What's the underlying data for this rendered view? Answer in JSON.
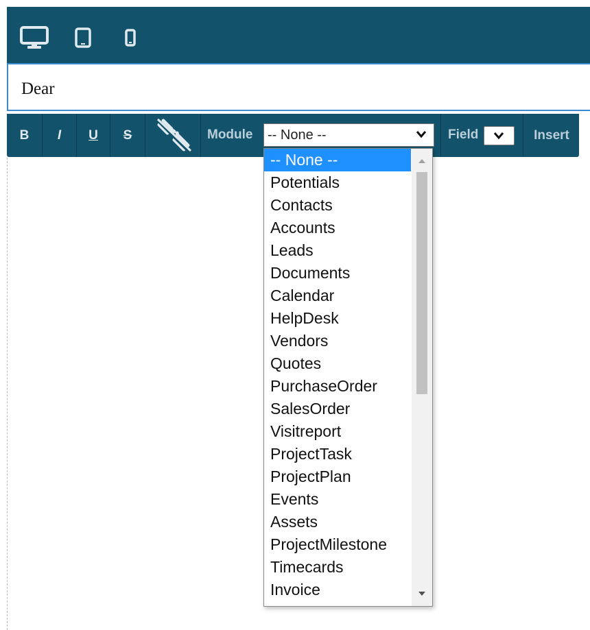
{
  "device_bar": {
    "icons": [
      "desktop-icon",
      "tablet-icon",
      "mobile-icon"
    ]
  },
  "editor": {
    "text": "Dear"
  },
  "toolbar": {
    "bold": "B",
    "italic": "I",
    "underline": "U",
    "strikethrough": "S",
    "link_icon": "unlink-icon",
    "module_label": "Module",
    "module_value": "-- None --",
    "field_label": "Field",
    "insert_label": "Insert"
  },
  "module_dropdown": {
    "selected_index": 0,
    "options": [
      "-- None --",
      "Potentials",
      "Contacts",
      "Accounts",
      "Leads",
      "Documents",
      "Calendar",
      "HelpDesk",
      "Vendors",
      "Quotes",
      "PurchaseOrder",
      "SalesOrder",
      "Visitreport",
      "ProjectTask",
      "ProjectPlan",
      "Events",
      "Assets",
      "ProjectMilestone",
      "Timecards",
      "Invoice"
    ]
  },
  "colors": {
    "toolbar_bg": "#13526b",
    "selection": "#1e90ff",
    "editor_border": "#3c8bd1"
  }
}
